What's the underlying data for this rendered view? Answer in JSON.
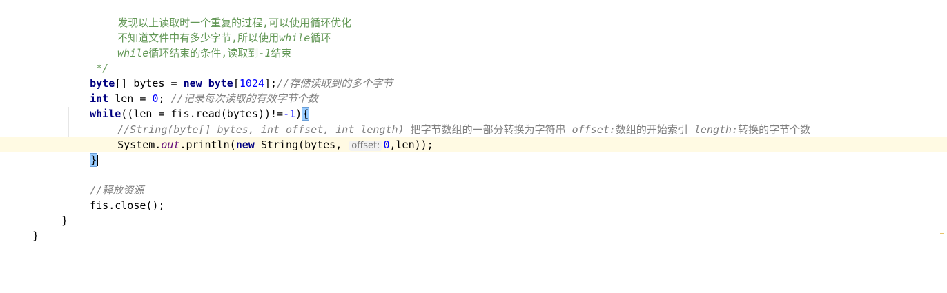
{
  "editor": {
    "lines": [
      {
        "text": "发现以上读取时一个重复的过程,可以使用循环优化"
      },
      {
        "text_a": "不知道文件中有多少字节,所以使用",
        "text_b": "while",
        "text_c": "循环"
      },
      {
        "text_a": "while",
        "text_b": "循环结束的条件,读取到",
        "text_c": "-1",
        "text_d": "结束"
      },
      {
        "text": " */"
      },
      {
        "kw1": "byte",
        "p1": "[] bytes = ",
        "kw2": "new",
        "p2": " ",
        "kw3": "byte",
        "p3": "[",
        "num": "1024",
        "p4": "];",
        "cm": "//存储读取到的多个字节"
      },
      {
        "kw": "int",
        "p1": " len = ",
        "num": "0",
        "p2": "; ",
        "cm": "//记录每次读取的有效字节个数"
      },
      {
        "kw": "while",
        "p1": "((len = fis.read(bytes))!=",
        "num": "-1",
        "p2": ")",
        "brace": "{"
      },
      {
        "doc1": "//String(byte[] bytes, int offset, int length) ",
        "cn1": "把字节数组的一部分转换为字符串 ",
        "doc2": "offset:",
        "cn2": "数组的开始索引 ",
        "doc3": "length:",
        "cn3": "转换的字节个数"
      },
      {
        "p1": "System.",
        "fld": "out",
        "p2": ".println(",
        "kw": "new",
        "p3": " String(bytes, ",
        "hint": "offset:",
        "p4": " ",
        "num": "0",
        "p5": ",len));"
      },
      {
        "brace": "}"
      },
      {
        "text": ""
      },
      {
        "cm": "//释放资源"
      },
      {
        "text": "fis.close();"
      },
      {
        "text": "}"
      },
      {
        "text": "}"
      }
    ]
  }
}
